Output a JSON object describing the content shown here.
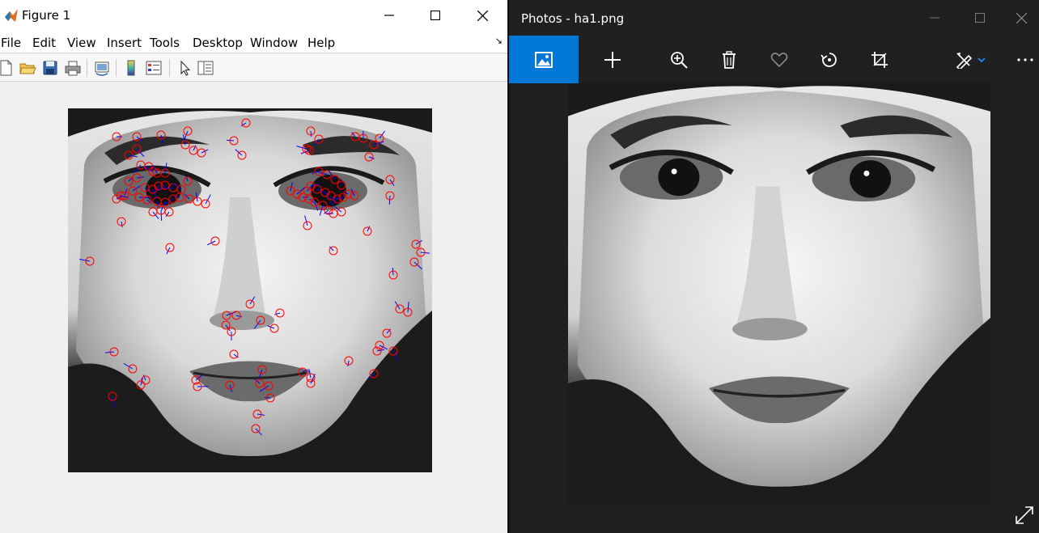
{
  "figure_window": {
    "title": "Figure 1",
    "menu": [
      "File",
      "Edit",
      "View",
      "Insert",
      "Tools",
      "Desktop",
      "Window",
      "Help"
    ],
    "toolbar_icons": [
      "new-figure-icon",
      "open-file-icon",
      "save-icon",
      "print-icon",
      "link-plot-icon",
      "insert-colorbar-icon",
      "insert-legend-icon",
      "pointer-icon",
      "property-inspector-icon"
    ],
    "colors": {
      "keypoint_circle": "#ff0000",
      "orientation_line": "#0000ff",
      "background": "#f0f0f0"
    }
  },
  "photos_window": {
    "title": "Photos - ha1.png",
    "commands": [
      "view-image-icon",
      "add-icon",
      "zoom-in-icon",
      "delete-icon",
      "favorite-icon",
      "rotate-icon",
      "crop-icon",
      "edit-draw-icon",
      "more-options-icon"
    ],
    "colors": {
      "accent": "#0078d7",
      "chrome": "#202020"
    }
  }
}
